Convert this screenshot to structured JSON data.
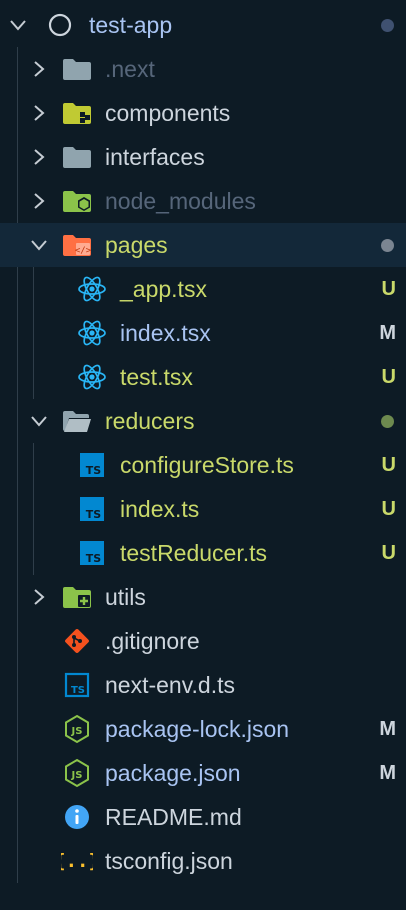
{
  "colors": {
    "background": "#0d1b25",
    "selected_row": "#132839",
    "untracked": "#c9d96a",
    "modified": "#a9c4f2",
    "default_text": "#cdd5dd",
    "ignored_text": "#56667a",
    "badge_modified": "#cdd5dd",
    "dot_gray": "#7b8591",
    "dot_green": "#6d8a4f"
  },
  "tree": [
    {
      "name": "test-app",
      "depth": 0,
      "expanded": true,
      "icon": "repo-circle-icon",
      "status": "dot",
      "dot": "navy",
      "color": "modified"
    },
    {
      "name": ".next",
      "depth": 1,
      "expanded": false,
      "icon": "folder-icon",
      "color": "ignored"
    },
    {
      "name": "components",
      "depth": 1,
      "expanded": false,
      "icon": "components-folder-icon",
      "color": "default"
    },
    {
      "name": "interfaces",
      "depth": 1,
      "expanded": false,
      "icon": "folder-icon",
      "color": "default"
    },
    {
      "name": "node_modules",
      "depth": 1,
      "expanded": false,
      "icon": "node-folder-icon",
      "color": "ignored"
    },
    {
      "name": "pages",
      "depth": 1,
      "expanded": true,
      "icon": "pages-folder-icon",
      "status": "dot",
      "dot": "gray",
      "color": "untracked",
      "selected": true
    },
    {
      "name": "_app.tsx",
      "depth": 2,
      "icon": "react-icon",
      "status": "U",
      "color": "untracked"
    },
    {
      "name": "index.tsx",
      "depth": 2,
      "icon": "react-icon",
      "status": "M",
      "color": "modified"
    },
    {
      "name": "test.tsx",
      "depth": 2,
      "icon": "react-icon",
      "status": "U",
      "color": "untracked"
    },
    {
      "name": "reducers",
      "depth": 1,
      "expanded": true,
      "icon": "open-folder-icon",
      "status": "dot",
      "dot": "green",
      "color": "untracked"
    },
    {
      "name": "configureStore.ts",
      "depth": 2,
      "icon": "typescript-icon",
      "status": "U",
      "color": "untracked"
    },
    {
      "name": "index.ts",
      "depth": 2,
      "icon": "typescript-icon",
      "status": "U",
      "color": "untracked"
    },
    {
      "name": "testReducer.ts",
      "depth": 2,
      "icon": "typescript-icon",
      "status": "U",
      "color": "untracked"
    },
    {
      "name": "utils",
      "depth": 1,
      "expanded": false,
      "icon": "utils-folder-icon",
      "color": "default"
    },
    {
      "name": ".gitignore",
      "depth": 1,
      "icon": "git-icon",
      "color": "default"
    },
    {
      "name": "next-env.d.ts",
      "depth": 1,
      "icon": "typescript-outline-icon",
      "color": "default"
    },
    {
      "name": "package-lock.json",
      "depth": 1,
      "icon": "nodejs-icon",
      "status": "M",
      "color": "modified"
    },
    {
      "name": "package.json",
      "depth": 1,
      "icon": "nodejs-icon",
      "status": "M",
      "color": "modified"
    },
    {
      "name": "README.md",
      "depth": 1,
      "icon": "info-icon",
      "color": "default"
    },
    {
      "name": "tsconfig.json",
      "depth": 1,
      "icon": "json-braces-icon",
      "color": "default"
    }
  ]
}
